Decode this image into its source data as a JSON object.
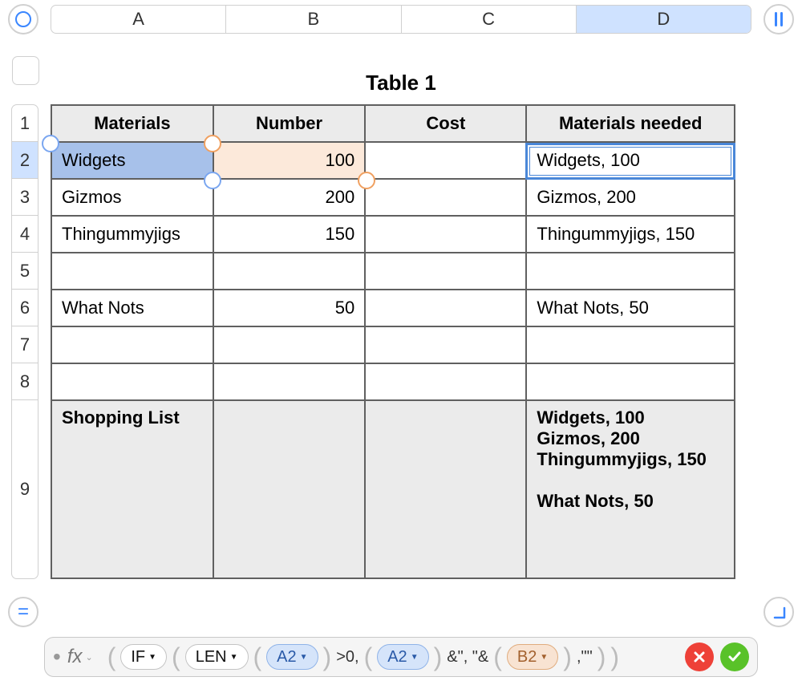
{
  "columns": [
    "A",
    "B",
    "C",
    "D"
  ],
  "active_column_index": 3,
  "rows": [
    "1",
    "2",
    "3",
    "4",
    "5",
    "6",
    "7",
    "8",
    "9"
  ],
  "active_row_index": 1,
  "table": {
    "title": "Table 1",
    "headers": {
      "c0": "Materials",
      "c1": "Number",
      "c2": "Cost",
      "c3": "Materials needed"
    },
    "body": [
      {
        "c0": "Widgets",
        "c1": "100",
        "c2": "",
        "c3": "Widgets, 100"
      },
      {
        "c0": "Gizmos",
        "c1": "200",
        "c2": "",
        "c3": "Gizmos, 200"
      },
      {
        "c0": "Thingummyjigs",
        "c1": "150",
        "c2": "",
        "c3": "Thingummyjigs, 150"
      },
      {
        "c0": "",
        "c1": "",
        "c2": "",
        "c3": ""
      },
      {
        "c0": "What Nots",
        "c1": "50",
        "c2": "",
        "c3": "What Nots, 50"
      },
      {
        "c0": "",
        "c1": "",
        "c2": "",
        "c3": ""
      },
      {
        "c0": "",
        "c1": "",
        "c2": "",
        "c3": ""
      }
    ],
    "footer": {
      "c0": "Shopping List",
      "c1": "",
      "c2": "",
      "c3_lines": [
        "Widgets, 100",
        "Gizmos, 200",
        "Thingummyjigs, 150",
        "",
        "What Nots, 50"
      ]
    }
  },
  "formula": {
    "fx_label": "fx",
    "if_label": "IF",
    "len_label": "LEN",
    "ref_a2": "A2",
    "gt0": ">0,",
    "ref_a2_2": "A2",
    "concat1": "&\", \"&",
    "ref_b2": "B2",
    "tail": ",\"\""
  },
  "icons": {
    "equals": "="
  }
}
